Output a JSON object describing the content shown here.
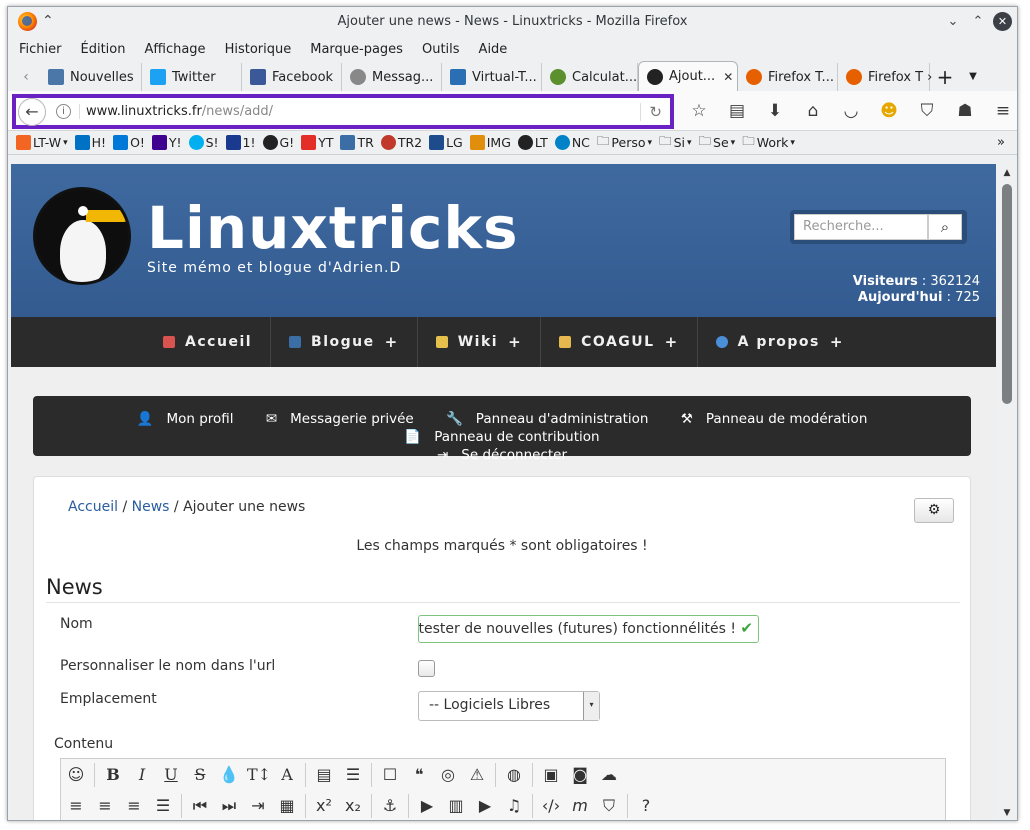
{
  "window": {
    "title": "Ajouter une news - News - Linuxtricks - Mozilla Firefox"
  },
  "menu": [
    "Fichier",
    "Édition",
    "Affichage",
    "Historique",
    "Marque-pages",
    "Outils",
    "Aide"
  ],
  "tabs": [
    {
      "label": "Nouvelles",
      "icon": "vk-icon",
      "color": "#4a76a8"
    },
    {
      "label": "Twitter",
      "icon": "twitter-icon",
      "color": "#1da1f2"
    },
    {
      "label": "Facebook",
      "icon": "facebook-icon",
      "color": "#3b5998"
    },
    {
      "label": "Messag...",
      "icon": "messenger-icon",
      "color": "#666666"
    },
    {
      "label": "Virtual-T...",
      "icon": "virtualt-icon",
      "color": "#2a6fb3"
    },
    {
      "label": "Calculat...",
      "icon": "calculator-icon",
      "color": "#5c8f2d"
    },
    {
      "label": "Ajout...",
      "icon": "linuxtricks-icon",
      "color": "#222222",
      "active": true
    },
    {
      "label": "Firefox T...",
      "icon": "firefox-icon",
      "color": "#e66000"
    },
    {
      "label": "Firefox T",
      "icon": "firefox-icon",
      "color": "#e66000"
    }
  ],
  "urlbar": {
    "domain": "www.linuxtricks.fr",
    "path": "/news/add/"
  },
  "bookmarks": [
    {
      "label": "LT-W",
      "chev": true,
      "color": "#f26522"
    },
    {
      "label": "H!",
      "color": "#0072c6"
    },
    {
      "label": "O!",
      "color": "#0078d7"
    },
    {
      "label": "Y!",
      "color": "#400090"
    },
    {
      "label": "S!",
      "color": "#00aff0"
    },
    {
      "label": "1!",
      "color": "#1a3a8f"
    },
    {
      "label": "G!",
      "color": "#222222"
    },
    {
      "label": "YT",
      "color": "#e52d27"
    },
    {
      "label": "TR",
      "color": "#3a6ea5"
    },
    {
      "label": "TR2",
      "color": "#c0392b"
    },
    {
      "label": "LG",
      "color": "#1e4b8c"
    },
    {
      "label": "IMG",
      "color": "#e08e0b"
    },
    {
      "label": "LT",
      "color": "#222222"
    },
    {
      "label": "NC",
      "color": "#0082c9"
    },
    {
      "label": "Perso",
      "chev": true,
      "folder": true
    },
    {
      "label": "Si",
      "chev": true,
      "folder": true
    },
    {
      "label": "Se",
      "chev": true,
      "folder": true
    },
    {
      "label": "Work",
      "chev": true,
      "folder": true
    }
  ],
  "site": {
    "brand": "Linuxtricks",
    "tagline": "Site mémo et blogue d'Adrien.D",
    "search_placeholder": "Recherche...",
    "visitors_label": "Visiteurs",
    "visitors_value": "362124",
    "today_label": "Aujourd'hui",
    "today_value": "725"
  },
  "mainnav": [
    {
      "label": "Accueil",
      "plus": false,
      "color": "#d9534f"
    },
    {
      "label": "Blogue",
      "plus": true,
      "color": "#3a6ea5"
    },
    {
      "label": "Wiki",
      "plus": true,
      "color": "#e6c04d"
    },
    {
      "label": "COAGUL",
      "plus": true,
      "color": "#e6b84d"
    },
    {
      "label": "A propos",
      "plus": true,
      "color": "#4a90d9"
    }
  ],
  "usermenu": [
    {
      "label": "Mon profil",
      "icon": "user-icon",
      "glyph": "👤"
    },
    {
      "label": "Messagerie privée",
      "icon": "envelope-icon",
      "glyph": "✉"
    },
    {
      "label": "Panneau d'administration",
      "icon": "wrench-icon",
      "glyph": "🔧"
    },
    {
      "label": "Panneau de modération",
      "icon": "gavel-icon",
      "glyph": "⚒"
    },
    {
      "label": "Panneau de contribution",
      "icon": "file-icon",
      "glyph": "📄"
    },
    {
      "label": "Se déconnecter",
      "icon": "logout-icon",
      "glyph": "⇥"
    }
  ],
  "page": {
    "breadcrumb": {
      "home": "Accueil",
      "section": "News",
      "current": "Ajouter une news"
    },
    "required_note": "Les champs marqués * sont obligatoires !",
    "section_title": "News",
    "nom_label": "Nom",
    "nom_value": "ır tester de nouvelles (futures) fonctionnélités !",
    "url_name_label": "Personnaliser le nom dans l'url",
    "emplacement_label": "Emplacement",
    "emplacement_value": "-- Logiciels Libres",
    "contenu_label": "Contenu"
  }
}
